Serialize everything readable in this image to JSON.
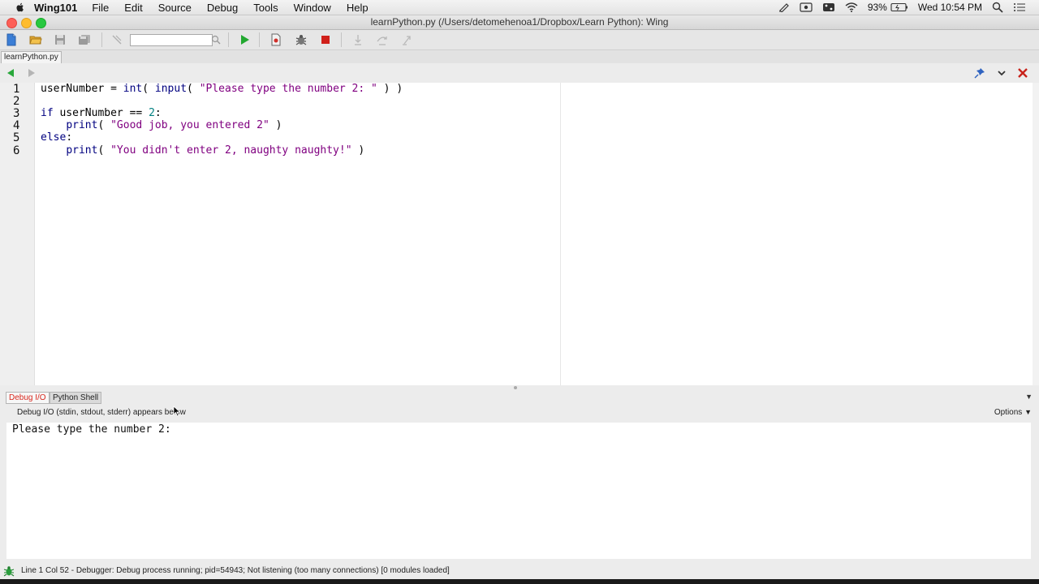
{
  "menubar": {
    "app_name": "Wing101",
    "items": [
      "File",
      "Edit",
      "Source",
      "Debug",
      "Tools",
      "Window",
      "Help"
    ],
    "battery": "93%",
    "clock": "Wed 10:54 PM"
  },
  "window": {
    "title": "learnPython.py (/Users/detomehenoa1/Dropbox/Learn Python): Wing"
  },
  "toolbar": {
    "search_value": ""
  },
  "editor": {
    "tab_label": "learnPython.py",
    "line_numbers": [
      "1",
      "2",
      "3",
      "4",
      "5",
      "6"
    ],
    "lines": {
      "l1": {
        "var": "userNumber",
        "op": " = ",
        "fn1": "int",
        "p1": "( ",
        "fn2": "input",
        "p2": "( ",
        "str": "\"Please type the number 2: \"",
        "close": " ) )"
      },
      "l3": {
        "kw": "if",
        "var": " userNumber ",
        "op": "== ",
        "num": "2",
        "colon": ":"
      },
      "l4": {
        "indent": "    ",
        "fn": "print",
        "open": "( ",
        "str": "\"Good job, you entered 2\"",
        "close": " )"
      },
      "l5": {
        "kw": "else",
        "colon": ":"
      },
      "l6": {
        "indent": "    ",
        "fn": "print",
        "open": "( ",
        "str": "\"You didn't enter 2, naughty naughty!\"",
        "close": " )"
      }
    }
  },
  "panel": {
    "tabs": [
      "Debug I/O",
      "Python Shell"
    ],
    "header": "Debug I/O (stdin, stdout, stderr) appears below",
    "options_label": "Options",
    "output": "Please type the number 2:"
  },
  "status": {
    "message": "Line 1 Col 52 - Debugger: Debug process running; pid=54943; Not listening (too many connections) [0 modules loaded]"
  },
  "colors": {
    "keyword": "#000080",
    "string": "#800080",
    "number": "#008080",
    "active_tab": "#d8281e"
  }
}
